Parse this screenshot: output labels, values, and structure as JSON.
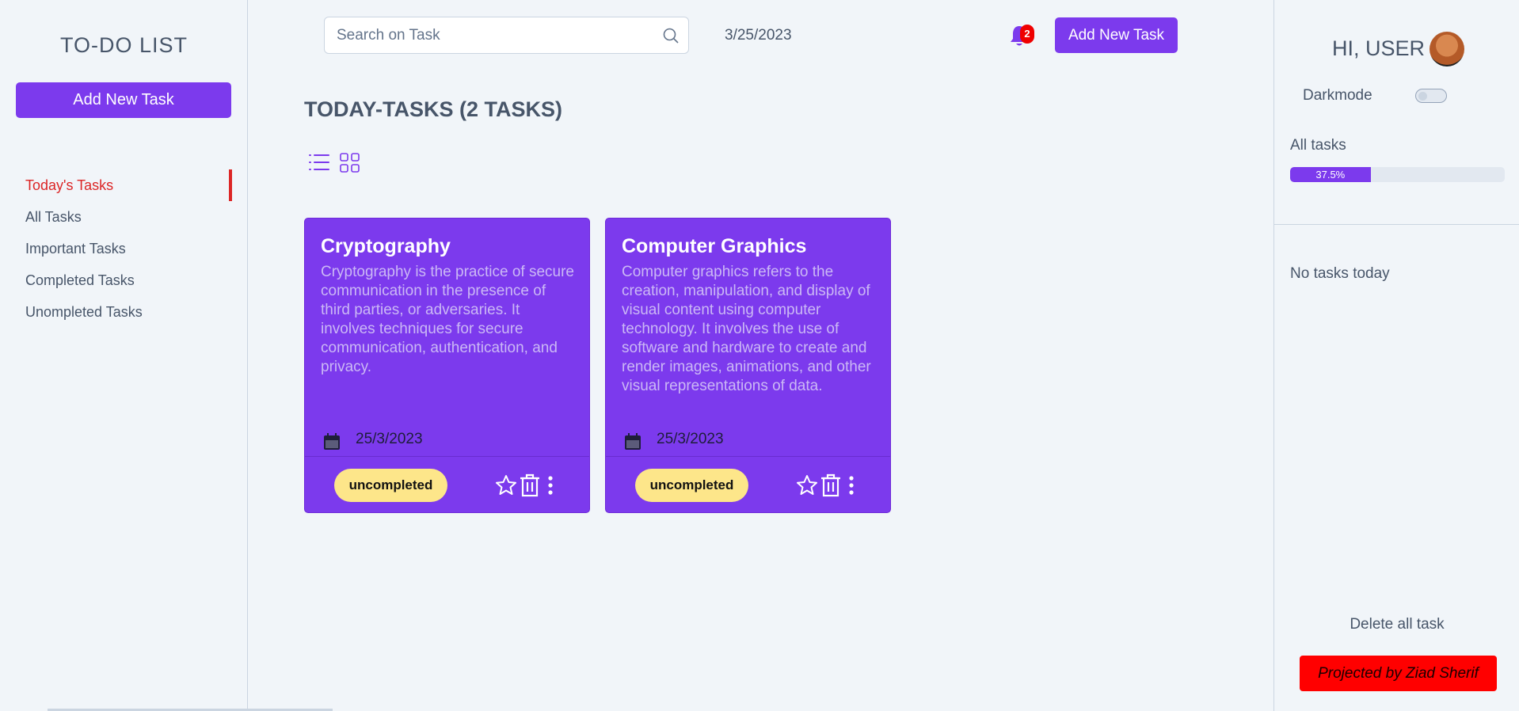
{
  "sidebar": {
    "app_title": "TO-DO LIST",
    "add_button_label": "Add New Task",
    "nav_items": [
      {
        "label": "Today's Tasks",
        "active": true
      },
      {
        "label": "All Tasks"
      },
      {
        "label": "Important Tasks"
      },
      {
        "label": "Completed Tasks"
      },
      {
        "label": "Unompleted Tasks"
      }
    ]
  },
  "header": {
    "search_placeholder": "Search on Task",
    "date": "3/25/2023",
    "notification_count": "2",
    "add_button_label": "Add New Task"
  },
  "main": {
    "title": "TODAY-TASKS (2 TASKS)",
    "view_modes": [
      "list-icon",
      "grid-icon"
    ],
    "tasks": [
      {
        "title": "Cryptography",
        "description": "Cryptography is the practice of secure communication in the presence of third parties, or adversaries. It involves techniques for secure communication, authentication, and privacy.",
        "date": "25/3/2023",
        "status": "uncompleted"
      },
      {
        "title": "Computer Graphics",
        "description": "Computer graphics refers to the creation, manipulation, and display of visual content using computer technology. It involves the use of software and hardware to create and render images, animations, and other visual representations of data.",
        "date": "25/3/2023",
        "status": "uncompleted"
      }
    ]
  },
  "right_panel": {
    "greeting": "HI, USER",
    "darkmode_label": "Darkmode",
    "darkmode_on": false,
    "all_tasks_label": "All tasks",
    "progress_percent": 37.5,
    "progress_text": "37.5%",
    "no_tasks_text": "No tasks today",
    "delete_all_label": "Delete all task",
    "credit_label": "Projected by Ziad Sherif"
  },
  "colors": {
    "accent": "#7c3aed",
    "active_nav": "#dc2626",
    "status_pill": "#fde68a",
    "credit_bg": "#ff0000",
    "background": "#f1f5f9"
  }
}
